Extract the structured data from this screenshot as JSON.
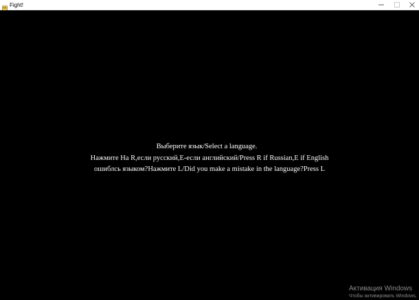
{
  "window": {
    "title": "Fight!",
    "controls": {
      "minimize": "minimize",
      "maximize": "maximize",
      "close": "close"
    }
  },
  "game": {
    "lines": [
      "Выберите язык/Select a language.",
      "Нажмите На R,если русский,E-если английский/Press R if Russian,E if English",
      "ошиблсь языком?Нажмите L/Did you make a mistake in the language?Press L"
    ],
    "text_color": "#ffffff",
    "background_color": "#000000"
  },
  "watermark": {
    "title": "Активация Windows",
    "subtitle": "Чтобы активировать Windows,"
  }
}
